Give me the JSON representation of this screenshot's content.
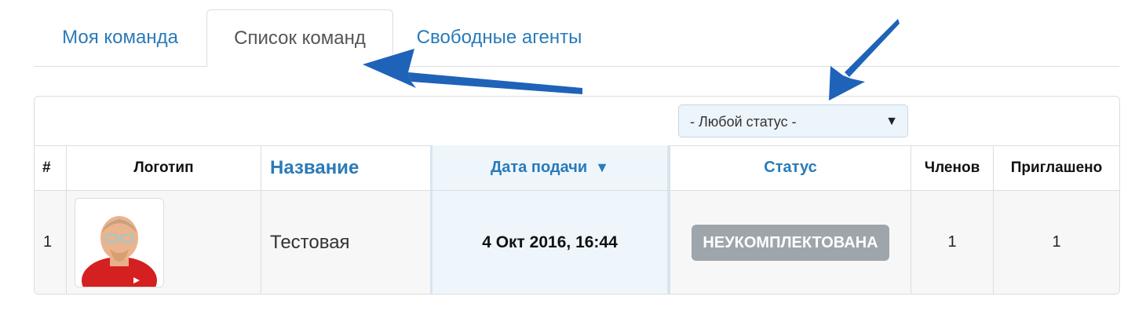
{
  "tabs": [
    {
      "label": "Моя команда",
      "active": false
    },
    {
      "label": "Список команд",
      "active": true
    },
    {
      "label": "Свободные агенты",
      "active": false
    }
  ],
  "filter": {
    "status_select": "- Любой статус -"
  },
  "table": {
    "columns": [
      "#",
      "Логотип",
      "Название",
      "Дата подачи",
      "Статус",
      "Членов",
      "Приглашено"
    ],
    "sort_indicator": "▼",
    "rows": [
      {
        "num": "1",
        "name": "Тестовая",
        "date": "4 Окт 2016, 16:44",
        "status": "НЕУКОМПЛЕКТОВАНА",
        "members": "1",
        "invited": "1"
      }
    ]
  },
  "colors": {
    "accent": "#2a7ab8",
    "badge": "#9ea5ab",
    "annotation_arrow": "#1e63b8"
  }
}
